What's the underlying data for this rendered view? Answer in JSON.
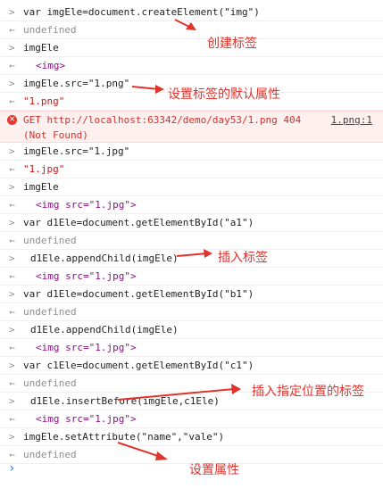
{
  "lines": [
    {
      "kind": "input",
      "text": "var imgEle=document.createElement(\"img\")"
    },
    {
      "kind": "result",
      "text": "undefined"
    },
    {
      "kind": "input",
      "text": "imgEle"
    },
    {
      "kind": "result",
      "text": "<img>"
    },
    {
      "kind": "input",
      "text": "imgEle.src=\"1.png\""
    },
    {
      "kind": "result",
      "text": "\"1.png\""
    },
    {
      "kind": "error",
      "text": "GET http://localhost:63342/demo/day53/1.png 404",
      "text2": "(Not Found)",
      "source": "1.png:1"
    },
    {
      "kind": "input",
      "text": "imgEle.src=\"1.jpg\""
    },
    {
      "kind": "result",
      "text": "\"1.jpg\""
    },
    {
      "kind": "input",
      "text": "imgEle"
    },
    {
      "kind": "result",
      "text": "<img src=\"1.jpg\">"
    },
    {
      "kind": "input",
      "text": "var d1Ele=document.getElementById(\"a1\")"
    },
    {
      "kind": "result",
      "text": "undefined"
    },
    {
      "kind": "input",
      "text": "d1Ele.appendChild(imgEle)"
    },
    {
      "kind": "result",
      "text": "<img src=\"1.jpg\">"
    },
    {
      "kind": "input",
      "text": "var d1Ele=document.getElementById(\"b1\")"
    },
    {
      "kind": "result",
      "text": "undefined"
    },
    {
      "kind": "input",
      "text": "d1Ele.appendChild(imgEle)"
    },
    {
      "kind": "result",
      "text": "<img src=\"1.jpg\">"
    },
    {
      "kind": "input",
      "text": "var c1Ele=document.getElementById(\"c1\")"
    },
    {
      "kind": "result",
      "text": "undefined"
    },
    {
      "kind": "input",
      "text": "d1Ele.insertBefore(imgEle,c1Ele)"
    },
    {
      "kind": "result",
      "text": "<img src=\"1.jpg\">"
    },
    {
      "kind": "input",
      "text": "imgEle.setAttribute(\"name\",\"vale\")"
    },
    {
      "kind": "result",
      "text": "undefined"
    }
  ],
  "annotations": {
    "create_tag": "创建标签",
    "set_default_attr": "设置标签的默认属性",
    "insert_tag": "插入标签",
    "insert_at_position": "插入指定位置的标签",
    "set_attr": "设置属性"
  },
  "colors": {
    "annotation": "#e0332c",
    "error_bg": "#fff0f0",
    "link": "#1a1aa6"
  }
}
